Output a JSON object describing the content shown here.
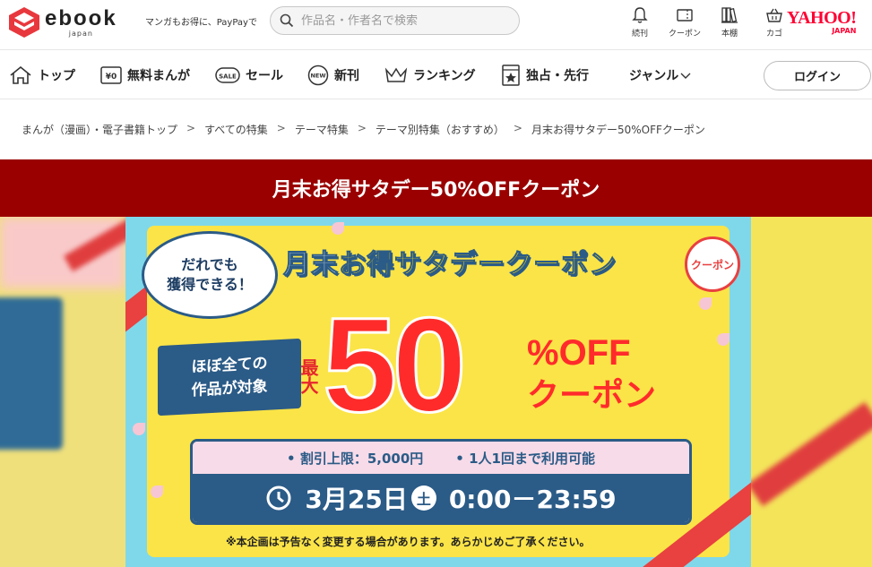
{
  "header": {
    "logo_text": "ebook",
    "logo_sub": "japan",
    "tagline": "マンガもお得に、PayPayで",
    "search_placeholder": "作品名・作者名で検索",
    "icons": [
      {
        "label": "続刊",
        "icon": "bell-icon"
      },
      {
        "label": "クーポン",
        "icon": "coupon-icon"
      },
      {
        "label": "本棚",
        "icon": "bookshelf-icon"
      },
      {
        "label": "カゴ",
        "icon": "cart-icon"
      }
    ],
    "yahoo_text": "YAHOO!",
    "yahoo_sub": "JAPAN"
  },
  "nav": {
    "items": [
      {
        "label": "トップ",
        "icon": "home-icon"
      },
      {
        "label": "無料まんが",
        "icon": "free-icon"
      },
      {
        "label": "セール",
        "icon": "sale-icon"
      },
      {
        "label": "新刊",
        "icon": "new-icon"
      },
      {
        "label": "ランキング",
        "icon": "crown-icon"
      },
      {
        "label": "独占・先行",
        "icon": "exclusive-icon"
      },
      {
        "label": "ジャンル",
        "icon": "chevron-down-icon"
      }
    ],
    "login_label": "ログイン"
  },
  "breadcrumb": [
    "まんが（漫画）・電子書籍トップ",
    "すべての特集",
    "テーマ特集",
    "テーマ別特集（おすすめ）",
    "月末お得サタデー50%OFFクーポン"
  ],
  "breadcrumb_sep": ">",
  "page_title": "月末お得サタデー50%OFFクーポン",
  "banner": {
    "bubble_line1": "だれでも",
    "bubble_line2": "獲得できる！",
    "headline_part1": "月末",
    "headline_part2": "お得",
    "headline_part3": "サタデークーポン",
    "badge": "クーポン",
    "book_line1": "ほぼ全ての",
    "book_line2": "作品が対象",
    "max_label": "最大",
    "big_number": "50",
    "off_text": "%OFF",
    "coupon_text": "クーポン",
    "limit_text": "• 割引上限：5,000円",
    "once_text": "• 1人1回まで利用可能",
    "date_text": "3月25日",
    "day_text": "土",
    "time_text": "0:00－23:59",
    "note": "※本企画は予告なく変更する場合があります。あらかじめご了承ください。"
  },
  "colors": {
    "title_bar": "#9a0000",
    "accent_red": "#ff2b2b",
    "navy": "#2b5b87",
    "yahoo_red": "#ff0033"
  }
}
